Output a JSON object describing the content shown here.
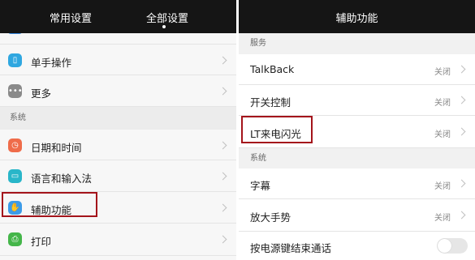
{
  "left": {
    "tabs": [
      "常用设置",
      "全部设置"
    ],
    "rows_top": [
      {
        "label": "单手操作",
        "icon": "one-hand-icon"
      },
      {
        "label": "更多",
        "icon": "more-icon"
      }
    ],
    "section_label": "系统",
    "rows_system": [
      {
        "label": "日期和时间",
        "icon": "clock-icon"
      },
      {
        "label": "语言和输入法",
        "icon": "keyboard-icon"
      },
      {
        "label": "辅助功能",
        "icon": "hand-icon"
      },
      {
        "label": "打印",
        "icon": "printer-icon"
      }
    ]
  },
  "right": {
    "title": "辅助功能",
    "section_service": "服务",
    "service_rows": [
      {
        "label": "TalkBack",
        "status": "关闭"
      },
      {
        "label": "开关控制",
        "status": "关闭"
      },
      {
        "label": "LT来电闪光",
        "status": "关闭"
      }
    ],
    "section_system": "系统",
    "system_rows": [
      {
        "label": "字幕",
        "status": "关闭"
      },
      {
        "label": "放大手势",
        "status": "关闭"
      }
    ],
    "toggle_row": {
      "label": "按电源键结束通话",
      "on": false
    }
  },
  "colors": {
    "highlight": "#a4141b",
    "topbar": "#151515"
  }
}
